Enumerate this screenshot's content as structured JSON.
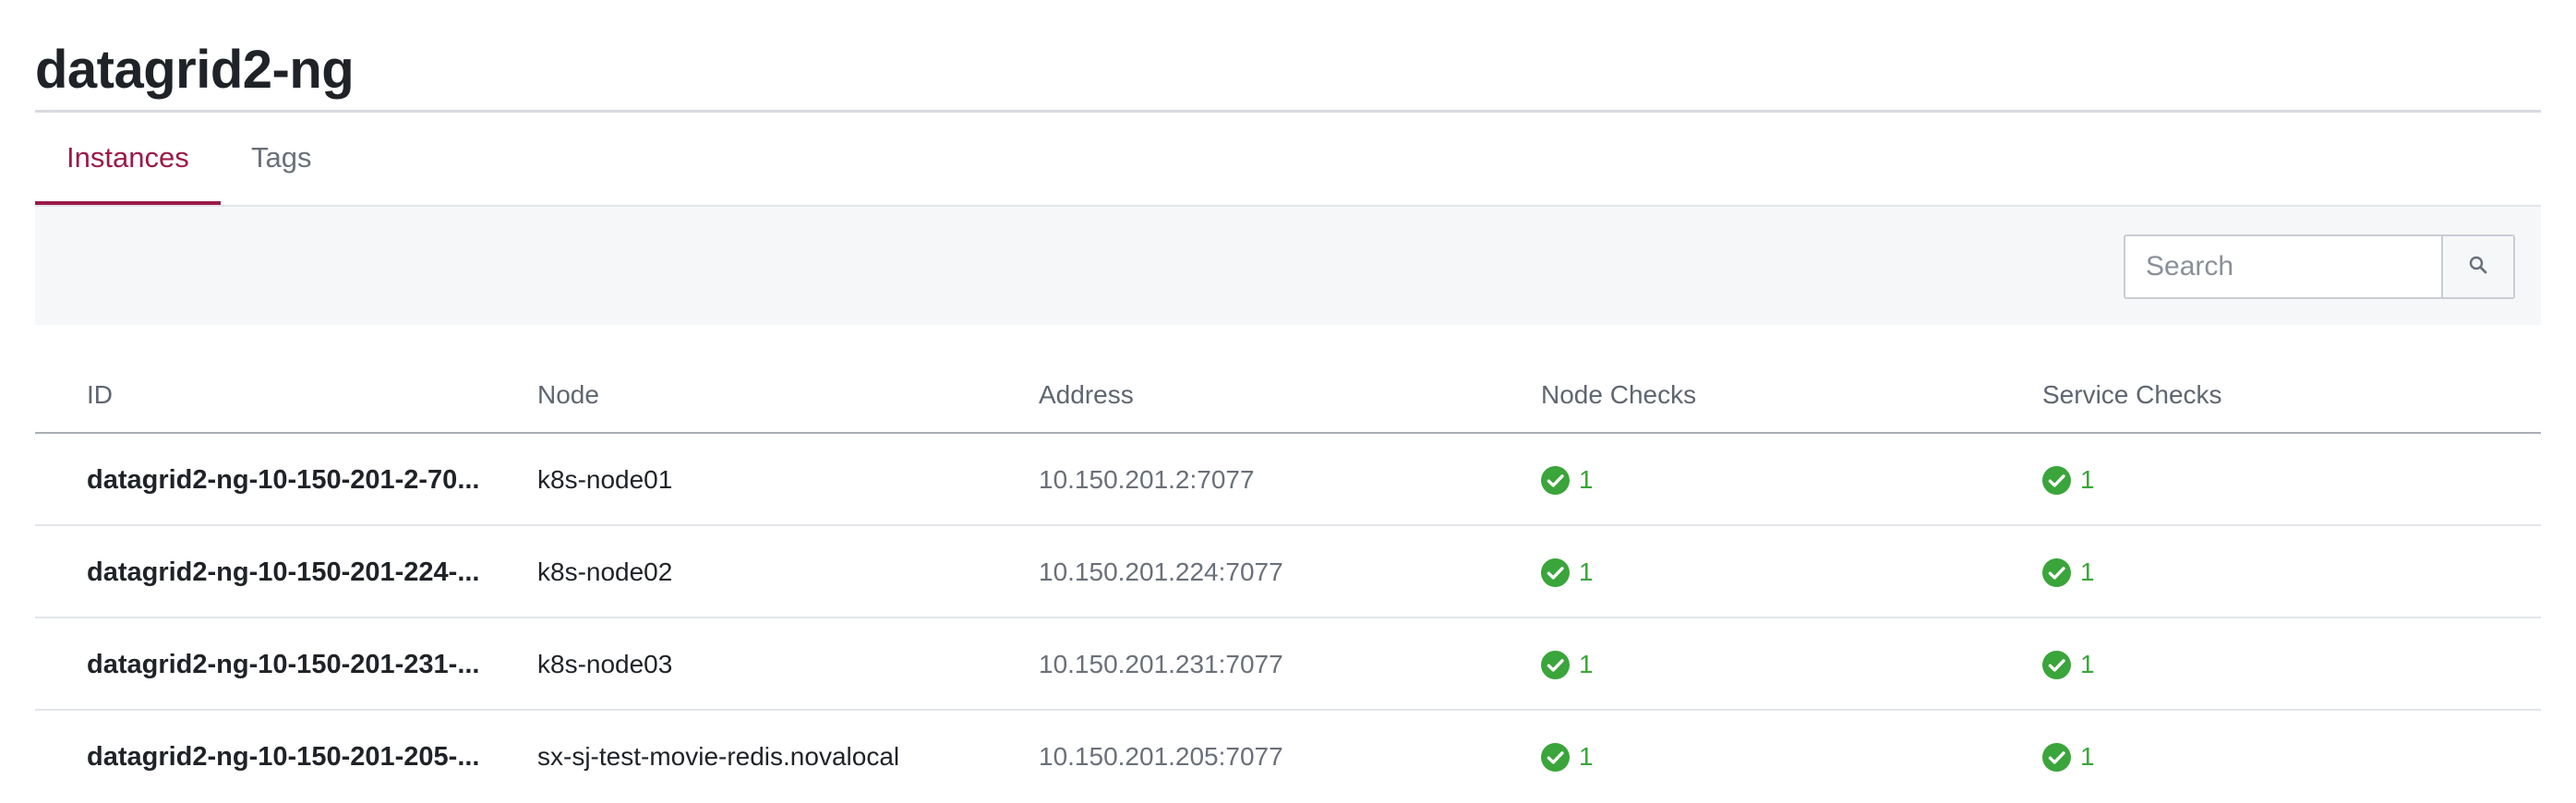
{
  "page": {
    "title": "datagrid2-ng"
  },
  "tabs": [
    {
      "label": "Instances",
      "active": true
    },
    {
      "label": "Tags",
      "active": false
    }
  ],
  "search": {
    "placeholder": "Search",
    "value": ""
  },
  "table": {
    "columns": [
      "ID",
      "Node",
      "Address",
      "Node Checks",
      "Service Checks"
    ],
    "rows": [
      {
        "id": "datagrid2-ng-10-150-201-2-70...",
        "node": "k8s-node01",
        "address": "10.150.201.2:7077",
        "node_checks": "1",
        "service_checks": "1"
      },
      {
        "id": "datagrid2-ng-10-150-201-224-...",
        "node": "k8s-node02",
        "address": "10.150.201.224:7077",
        "node_checks": "1",
        "service_checks": "1"
      },
      {
        "id": "datagrid2-ng-10-150-201-231-...",
        "node": "k8s-node03",
        "address": "10.150.201.231:7077",
        "node_checks": "1",
        "service_checks": "1"
      },
      {
        "id": "datagrid2-ng-10-150-201-205-...",
        "node": "sx-sj-test-movie-redis.novalocal",
        "address": "10.150.201.205:7077",
        "node_checks": "1",
        "service_checks": "1"
      }
    ]
  },
  "icons": {
    "search": "search-icon",
    "check": "check-circle-icon"
  },
  "colors": {
    "accent": "#9b1a4a",
    "passing": "#3aa53a"
  }
}
